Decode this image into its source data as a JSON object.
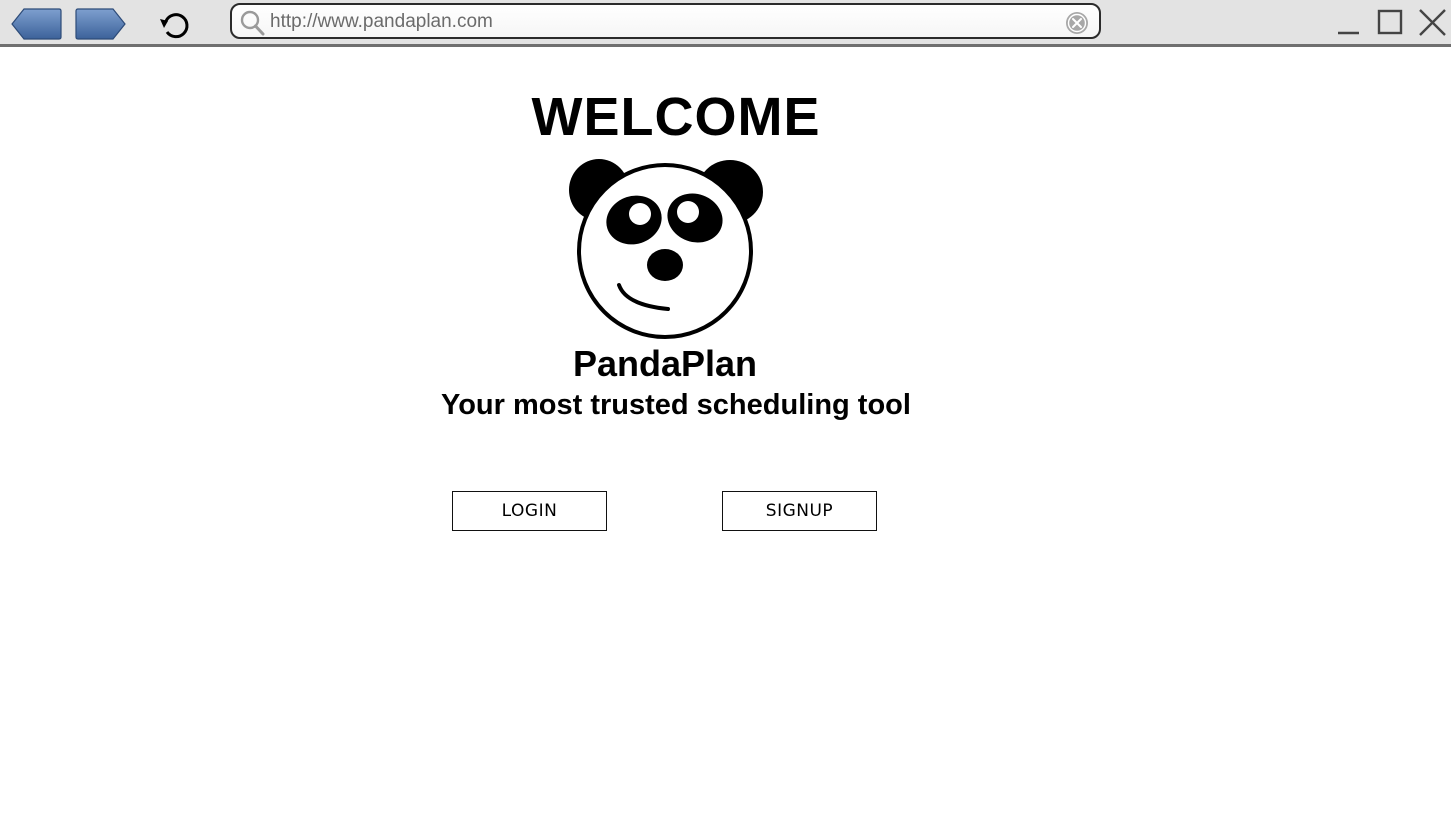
{
  "browser": {
    "url": "http://www.pandaplan.com",
    "icons": {
      "back": "back-arrow-icon",
      "forward": "forward-arrow-icon",
      "reload": "reload-icon",
      "search": "search-icon",
      "clear": "clear-icon",
      "minimize": "minimize-icon",
      "maximize": "maximize-icon",
      "close": "close-icon"
    },
    "nav_button_color": "#4a72a8"
  },
  "page": {
    "heading": "WELCOME",
    "logo": "panda-logo",
    "app_name": "PandaPlan",
    "tagline": "Your most trusted scheduling tool",
    "login_label": "LOGIN",
    "signup_label": "SIGNUP"
  }
}
